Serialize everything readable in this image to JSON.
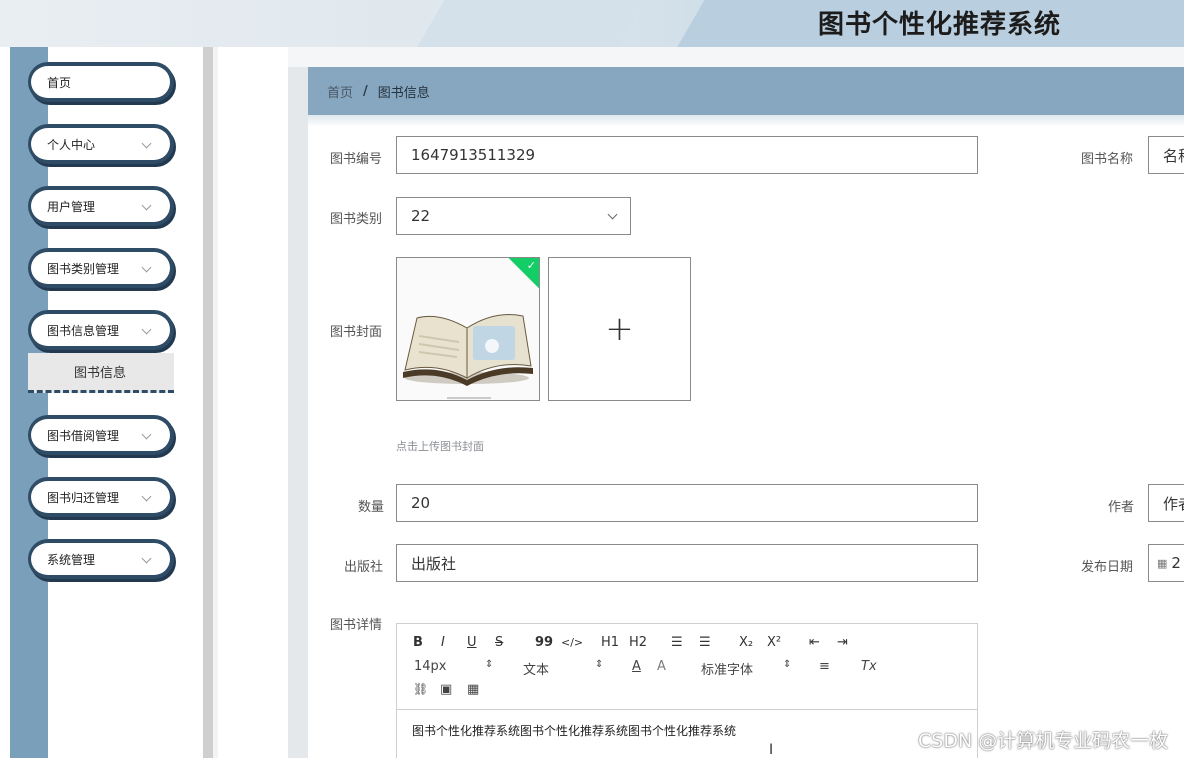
{
  "app": {
    "title": "图书个性化推荐系统"
  },
  "sidebar": {
    "items": [
      {
        "label": "首页",
        "has_arrow": false
      },
      {
        "label": "个人中心",
        "has_arrow": true
      },
      {
        "label": "用户管理",
        "has_arrow": true
      },
      {
        "label": "图书类别管理",
        "has_arrow": true
      },
      {
        "label": "图书信息管理",
        "has_arrow": true
      },
      {
        "label": "图书借阅管理",
        "has_arrow": true
      },
      {
        "label": "图书归还管理",
        "has_arrow": true
      },
      {
        "label": "系统管理",
        "has_arrow": true
      }
    ],
    "active_submenu": {
      "label": "图书信息"
    }
  },
  "breadcrumb": {
    "home": "首页",
    "separator": "/",
    "current": "图书信息"
  },
  "form": {
    "book_no": {
      "label": "图书编号",
      "value": "1647913511329"
    },
    "book_name": {
      "label": "图书名称",
      "value": "名称"
    },
    "category": {
      "label": "图书类别",
      "value": "22"
    },
    "cover": {
      "label": "图书封面",
      "hint": "点击上传图书封面",
      "add_symbol": "+",
      "uploaded_mark": "✓"
    },
    "quantity": {
      "label": "数量",
      "value": "20"
    },
    "author": {
      "label": "作者",
      "value": "作者"
    },
    "publisher": {
      "label": "出版社",
      "value": "出版社"
    },
    "publish_date": {
      "label": "发布日期",
      "value": "2"
    },
    "details": {
      "label": "图书详情",
      "toolbar": {
        "bold": "B",
        "italic": "I",
        "underline": "U",
        "strike": "S",
        "quote": "99",
        "code": "</>",
        "h1": "H1",
        "h2": "H2",
        "ordered_list": "☰",
        "bullet_list": "☰",
        "subscript": "X₂",
        "superscript": "X²",
        "outdent": "⇤",
        "indent": "⇥",
        "size": "14px",
        "text_style": "文本",
        "color": "A",
        "background": "A",
        "font": "标准字体",
        "align": "≡",
        "clear": "Tx",
        "link": "🔗",
        "image": "▣",
        "video": "▦"
      },
      "content": "图书个性化推荐系统图书个性化推荐系统图书个性化推荐系统"
    }
  },
  "watermark": "CSDN @计算机专业码农一枚",
  "colors": {
    "sidebar": "#7a9fba",
    "menu_border": "#2f4c66",
    "breadcrumb_bg": "#86a7bf",
    "success": "#13ce66"
  }
}
